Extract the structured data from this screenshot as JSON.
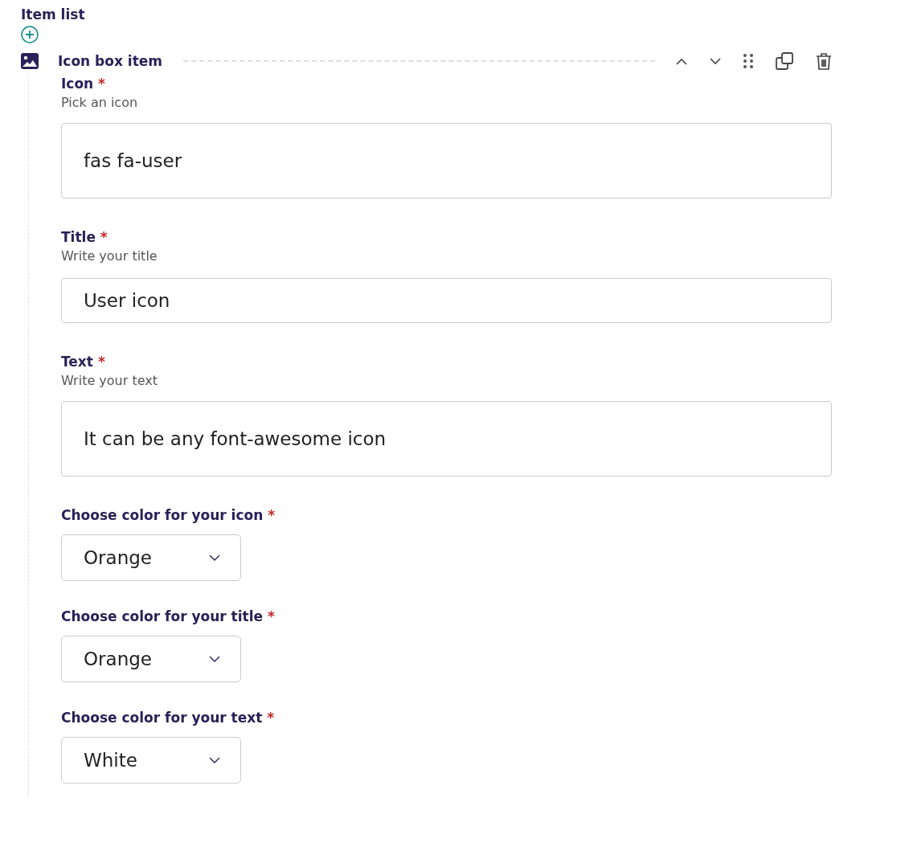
{
  "list_title": "Item list",
  "item": {
    "title": "Icon box item",
    "fields": [
      {
        "kind": "multiline",
        "label": "Icon",
        "required_mark": "*",
        "hint": "Pick an icon",
        "value": "fas fa-user"
      },
      {
        "kind": "text",
        "label": "Title",
        "required_mark": "*",
        "hint": "Write your title",
        "value": "User icon"
      },
      {
        "kind": "multiline",
        "label": "Text",
        "required_mark": "*",
        "hint": "Write your text",
        "value": "It can be any font-awesome icon"
      },
      {
        "kind": "select",
        "label": "Choose color for your icon",
        "required_mark": "*",
        "value": "Orange"
      },
      {
        "kind": "select",
        "label": "Choose color for your title",
        "required_mark": "*",
        "value": "Orange"
      },
      {
        "kind": "select",
        "label": "Choose color for your text",
        "required_mark": "*",
        "value": "White"
      }
    ]
  }
}
